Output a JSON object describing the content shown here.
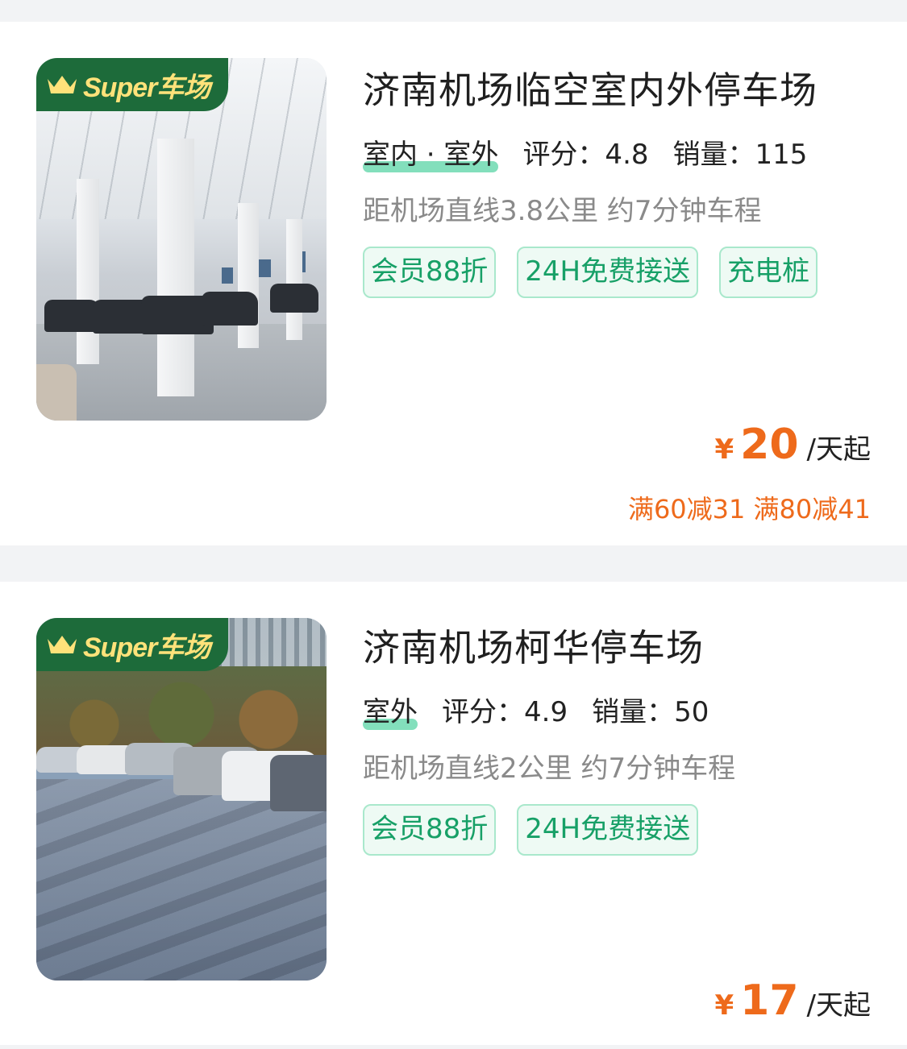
{
  "listings": [
    {
      "badge": "Super车场",
      "title": "济南机场临空室内外停车场",
      "type": "室内 · 室外",
      "rating_label": "评分：4.8",
      "sales_label": "销量：115",
      "distance": "距机场直线3.8公里 约7分钟车程",
      "tags": [
        "会员88折",
        "24H免费接送",
        "充电桩"
      ],
      "currency": "¥",
      "price": "20",
      "unit": "/天起",
      "promo": "满60减31 满80减41"
    },
    {
      "badge": "Super车场",
      "title": "济南机场柯华停车场",
      "type": "室外",
      "rating_label": "评分：4.9",
      "sales_label": "销量：50",
      "distance": "距机场直线2公里 约7分钟车程",
      "tags": [
        "会员88折",
        "24H免费接送"
      ],
      "currency": "¥",
      "price": "17",
      "unit": "/天起"
    }
  ],
  "colors": {
    "accent_green": "#17a067",
    "price_orange": "#ee6a1b",
    "badge_green": "#1d6b3a",
    "badge_text": "#ffe27a"
  }
}
